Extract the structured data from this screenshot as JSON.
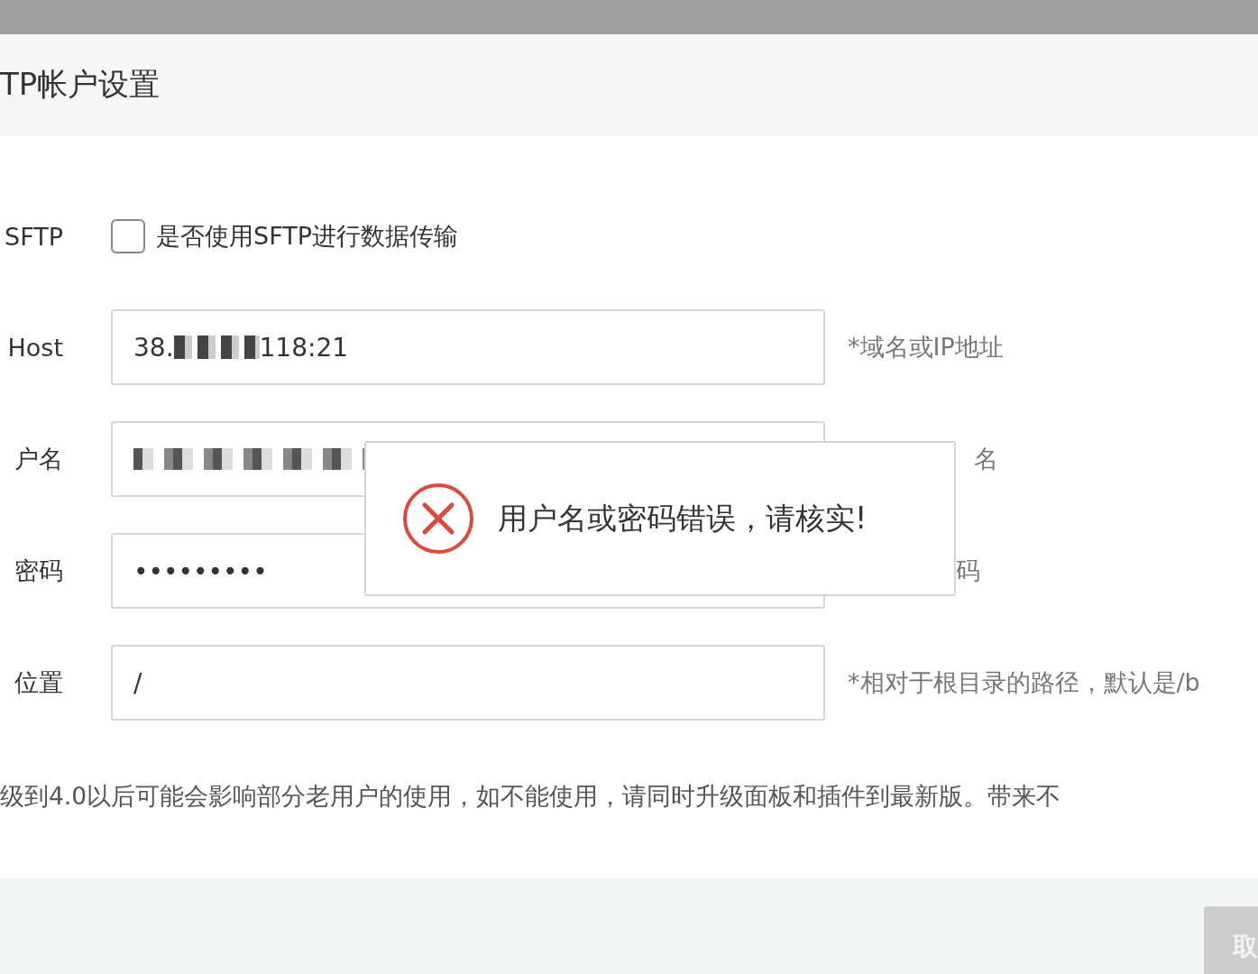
{
  "dialog": {
    "title": "TP帐户设置"
  },
  "rows": [
    {
      "label": "SFTP",
      "kind": "checkbox",
      "checked": false,
      "text": "是否使用SFTP进行数据传输"
    },
    {
      "label": "Host",
      "kind": "masked-input",
      "value_start": "38.",
      "value_end": "118:21",
      "hint": "*域名或IP地址"
    },
    {
      "label": "户名",
      "kind": "mosaic-input",
      "hint": "名"
    },
    {
      "label": "密码",
      "kind": "input",
      "value": "•••••••••",
      "hint": "码"
    },
    {
      "label": "位置",
      "kind": "input",
      "value": "/",
      "hint": "*相对于根目录的路径，默认是/b"
    }
  ],
  "notice": "级到4.0以后可能会影响部分老用户的使用，如不能使用，请同时升级面板和插件到最新版。带来不",
  "toast": {
    "message": "用户名或密码错误，请核实!"
  },
  "footer": {
    "button": "取",
    "disabled": true
  }
}
